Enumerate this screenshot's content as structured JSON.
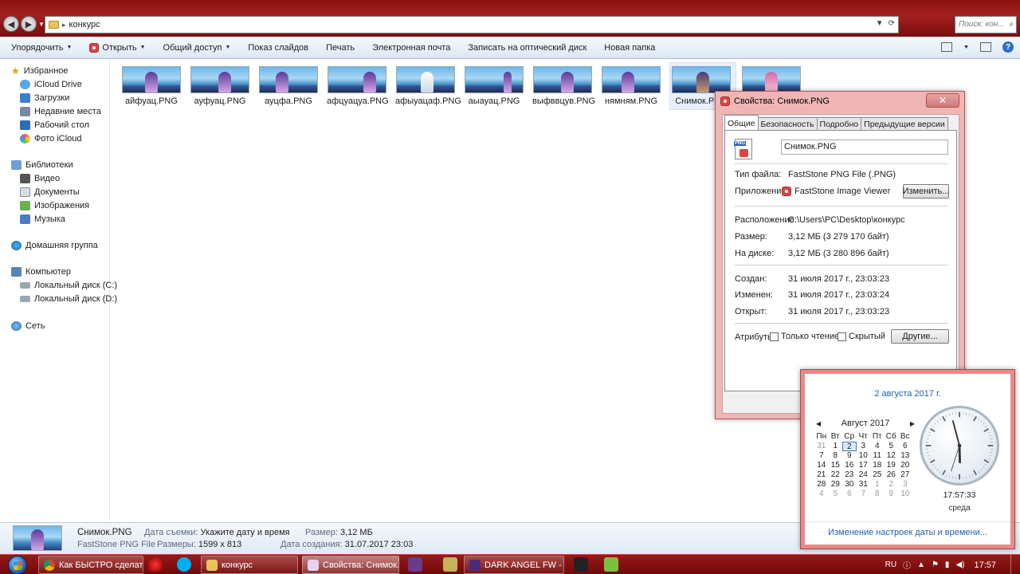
{
  "address": {
    "path": "конкурс",
    "search_placeholder": "Поиск: кон..."
  },
  "toolbar": {
    "organize": "Упорядочить",
    "open": "Открыть",
    "share": "Общий доступ",
    "slideshow": "Показ слайдов",
    "print": "Печать",
    "email": "Электронная почта",
    "burn": "Записать на оптический диск",
    "new_folder": "Новая папка"
  },
  "sidebar": {
    "favorites": {
      "label": "Избранное",
      "items": [
        "iCloud Drive",
        "Загрузки",
        "Недавние места",
        "Рабочий стол",
        "Фото iCloud"
      ]
    },
    "libraries": {
      "label": "Библиотеки",
      "items": [
        "Видео",
        "Документы",
        "Изображения",
        "Музыка"
      ]
    },
    "homegroup": "Домашняя группа",
    "computer": {
      "label": "Компьютер",
      "items": [
        "Локальный диск (C:)",
        "Локальный диск (D:)"
      ]
    },
    "network": "Сеть"
  },
  "files": [
    "айфуац.PNG",
    "ауфуац.PNG",
    "ауцфа.PNG",
    "афцуацуа.PNG",
    "афыуацаф.PNG",
    "аыауац.PNG",
    "выфввцув.PNG",
    "нямням.PNG",
    "Снимок.PNG",
    ""
  ],
  "details": {
    "name": "Снимок.PNG",
    "type": "FastStone PNG File",
    "date_taken_label": "Дата съемки:",
    "date_taken_value": "Укажите дату и время",
    "dimensions_label": "Размеры:",
    "dimensions_value": "1599 x 813",
    "size_label": "Размер:",
    "size_value": "3,12 МБ",
    "created_label": "Дата создания:",
    "created_value": "31.07.2017 23:03"
  },
  "dialog": {
    "title": "Свойства: Снимок.PNG",
    "tabs": [
      "Общие",
      "Безопасность",
      "Подробно",
      "Предыдущие версии"
    ],
    "file_name": "Снимок.PNG",
    "type_label": "Тип файла:",
    "type_value": "FastStone PNG File (.PNG)",
    "app_label": "Приложение:",
    "app_value": "FastStone Image Viewer",
    "change_button": "Изменить...",
    "location_label": "Расположение:",
    "location_value": "C:\\Users\\PC\\Desktop\\конкурс",
    "size_label": "Размер:",
    "size_value": "3,12 МБ (3 279 170 байт)",
    "disk_label": "На диске:",
    "disk_value": "3,12 МБ (3 280 896 байт)",
    "created_label": "Создан:",
    "created_value": "31 июля 2017 г., 23:03:23",
    "modified_label": "Изменен:",
    "modified_value": "31 июля 2017 г., 23:03:24",
    "opened_label": "Открыт:",
    "opened_value": "31 июля 2017 г., 23:03:23",
    "attributes_label": "Атрибуты:",
    "readonly_label": "Только чтение",
    "hidden_label": "Скрытый",
    "other_button": "Другие..."
  },
  "calendar": {
    "full_date": "2 августа 2017 г.",
    "month": "Август 2017",
    "weekdays": [
      "Пн",
      "Вт",
      "Ср",
      "Чт",
      "Пт",
      "Сб",
      "Вс"
    ],
    "days": [
      "31",
      "1",
      "2",
      "3",
      "4",
      "5",
      "6",
      "7",
      "8",
      "9",
      "10",
      "11",
      "12",
      "13",
      "14",
      "15",
      "16",
      "17",
      "18",
      "19",
      "20",
      "21",
      "22",
      "23",
      "24",
      "25",
      "26",
      "27",
      "28",
      "29",
      "30",
      "31",
      "1",
      "2",
      "3",
      "4",
      "5",
      "6",
      "7",
      "8",
      "9",
      "10"
    ],
    "today_index": 2,
    "time": "17:57:33",
    "weekday": "среда",
    "settings_link": "Изменение настроек даты и времени...",
    "clock": {
      "hours": 17,
      "minutes": 57,
      "seconds": 33
    }
  },
  "taskbar": {
    "tasks": [
      "Как БЫСТРО сделат...",
      "конкурс",
      "Свойства: Снимок.P...",
      "DARK ANGEL FW - F..."
    ],
    "language": "RU",
    "clock": "17:57"
  },
  "colors": {
    "accent": "#1f5eb5",
    "window_frame": "#a52020",
    "dialog_frame": "#f0b6b6"
  }
}
